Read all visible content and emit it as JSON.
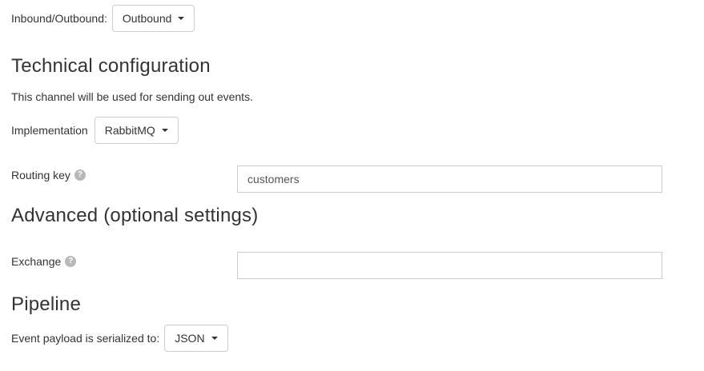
{
  "colors": {
    "background": "#ffffff",
    "text": "#333333",
    "input_text": "#555555",
    "control_border": "#cccccc",
    "help_icon_bg": "#b8b8b8",
    "help_icon_fg": "#ffffff"
  },
  "form": {
    "direction": {
      "label": "Inbound/Outbound:",
      "dropdown_value": "Outbound"
    },
    "technical": {
      "heading": "Technical configuration",
      "description": "This channel will be used for sending out events.",
      "implementation": {
        "label": "Implementation",
        "dropdown_value": "RabbitMQ"
      },
      "routing_key": {
        "label": "Routing key",
        "help_glyph": "?",
        "value": "customers"
      }
    },
    "advanced": {
      "heading": "Advanced (optional settings)",
      "exchange": {
        "label": "Exchange",
        "help_glyph": "?",
        "value": ""
      }
    },
    "pipeline": {
      "heading": "Pipeline",
      "serialization": {
        "label": "Event payload is serialized to:",
        "dropdown_value": "JSON"
      }
    }
  }
}
